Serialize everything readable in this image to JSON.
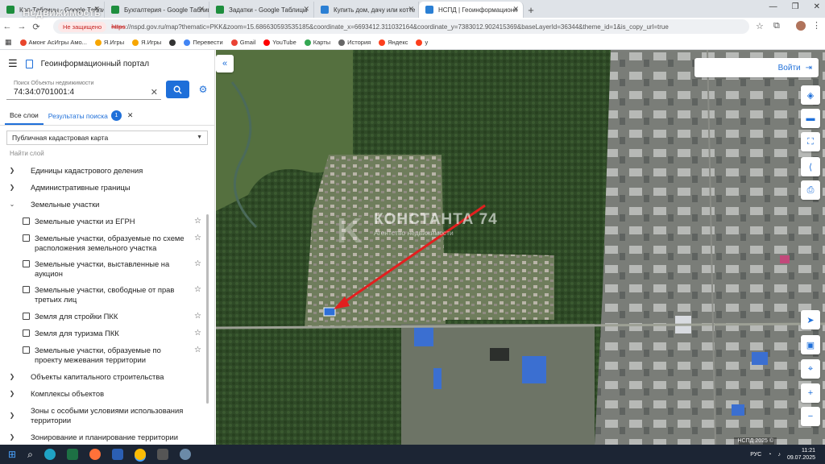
{
  "browser": {
    "tabs": [
      {
        "label": "Кол-Таблицы - Google Таблиц",
        "favicon_color": "#1e8e3e",
        "active": false
      },
      {
        "label": "Бухгалтерия - Google Таблиц",
        "favicon_color": "#1e8e3e",
        "active": false
      },
      {
        "label": "Задатки - Google Таблицы",
        "favicon_color": "#1e8e3e",
        "active": false
      },
      {
        "label": "Купить дом, дачу или котте",
        "favicon_color": "#2a7fd4",
        "active": false
      },
      {
        "label": "НСПД | Геоинформационн",
        "favicon_color": "#2a7fd4",
        "active": true
      }
    ],
    "new_tab": "+",
    "insecure_label": "Не защищено",
    "url_proto": "https",
    "url_rest": "://nspd.gov.ru/map?thematic=PKK&zoom=15.686630593535185&coordinate_x=6693412.311032164&coordinate_y=7383012.902415369&baseLayerId=36344&theme_id=1&is_copy_url=true",
    "bookmarks": [
      {
        "label": "Амонг АсИгры Амо...",
        "color": "#e8452c"
      },
      {
        "label": "Я.Игры",
        "color": "#f7a600"
      },
      {
        "label": "Я.Игры",
        "color": "#f7a600"
      },
      {
        "label": "",
        "color": "#333333"
      },
      {
        "label": "Перевести",
        "color": "#4285f4"
      },
      {
        "label": "Gmail",
        "color": "#ea4335"
      },
      {
        "label": "YouTube",
        "color": "#ff0000"
      },
      {
        "label": "Карты",
        "color": "#34a853"
      },
      {
        "label": "История",
        "color": "#666666"
      },
      {
        "label": "Яндекс",
        "color": "#fc3f1d"
      },
      {
        "label": "y",
        "color": "#fc3f1d"
      }
    ]
  },
  "watermark_top": {
    "text": "Недвижимость"
  },
  "sidebar": {
    "title": "Геоинформационный портал",
    "search": {
      "label": "Поиск Объекты недвижимости",
      "value": "74:34:0701001:4"
    },
    "tabs": {
      "all_layers": "Все слои",
      "search_results": "Результаты поиска",
      "results_count": "1"
    },
    "basemap_select": "Публичная кадастровая карта",
    "find_layer_placeholder": "Найти слой",
    "tree": [
      {
        "label": "Единицы кадастрового деления",
        "expanded": false
      },
      {
        "label": "Административные границы",
        "expanded": false
      },
      {
        "label": "Земельные участки",
        "expanded": true,
        "children": [
          "Земельные участки из ЕГРН",
          "Земельные участки, образуемые по схеме расположения земельного участка",
          "Земельные участки, выставленные на аукцион",
          "Земельные участки, свободные от прав третьих лиц",
          "Земля для стройки ПКК",
          "Земля для туризма ПКК",
          "Земельные участки, образуемые по проекту межевания территории"
        ]
      },
      {
        "label": "Объекты капитального строительства",
        "expanded": false
      },
      {
        "label": "Комплексы объектов",
        "expanded": false
      },
      {
        "label": "Зоны с особыми условиями использования территории",
        "expanded": false
      },
      {
        "label": "Зонирование и планирование территории",
        "expanded": false
      }
    ]
  },
  "map": {
    "login_label": "Войти",
    "watermark_title": "КОНСТАНТА 74",
    "watermark_sub": "Агентство недвижимости",
    "copyright": "НСПД 2025 ©"
  },
  "taskbar": {
    "lang": "РУС",
    "time": "11:21",
    "date": "09.07.2025"
  }
}
